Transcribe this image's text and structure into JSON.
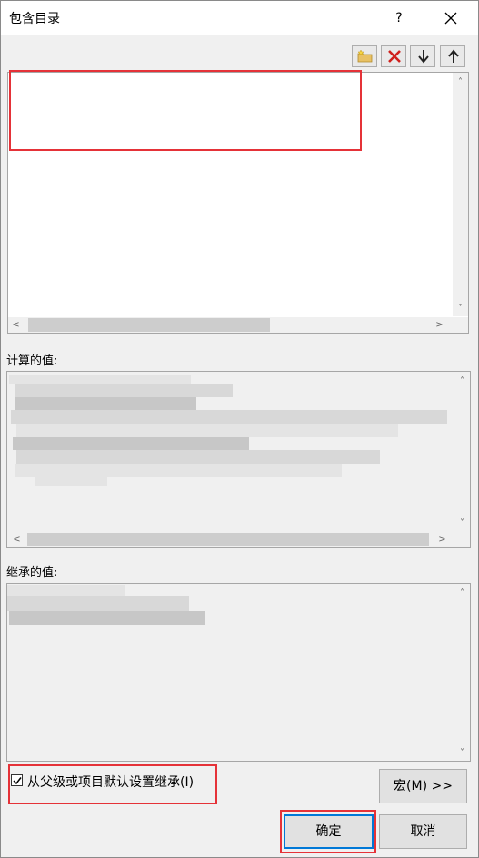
{
  "window": {
    "title": "包含目录",
    "help_label": "?"
  },
  "toolbar": {
    "new_icon": "new-folder-icon",
    "delete_icon": "delete-icon",
    "move_down_icon": "arrow-down-icon",
    "move_up_icon": "arrow-up-icon"
  },
  "sections": {
    "computed_label": "计算的值:",
    "inherited_label": "继承的值:"
  },
  "options": {
    "inherit_checked": true,
    "inherit_label": "从父级或项目默认设置继承(I)"
  },
  "buttons": {
    "macros": "宏(M) >>",
    "ok": "确定",
    "cancel": "取消"
  },
  "colors": {
    "highlight": "#e53238",
    "focus": "#0078d7"
  }
}
